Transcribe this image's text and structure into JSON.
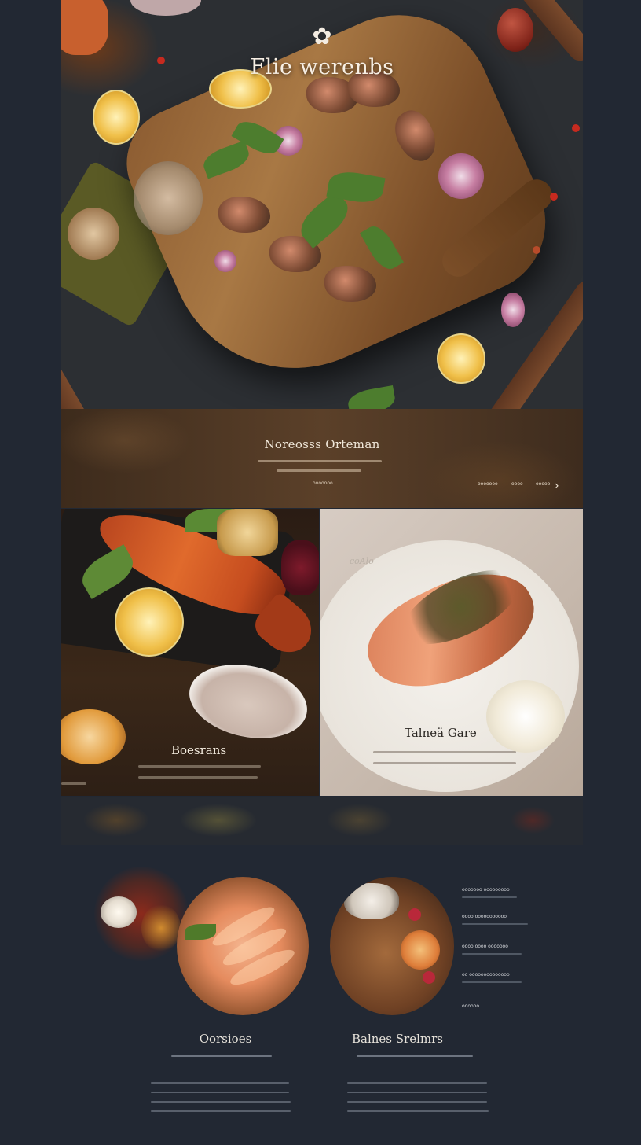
{
  "hero": {
    "title": "Flie werenbs"
  },
  "banner": {
    "title": "Noreosss Orteman",
    "nav_left": "ooooooo",
    "nav_mid": "oooo",
    "nav_right": "ooooo",
    "arrow": "›"
  },
  "cards": {
    "left": {
      "title": "Boesrans"
    },
    "right": {
      "title": "Talneä Gare",
      "plate_mark": "coAlo"
    }
  },
  "lower": {
    "sidebar": [
      {
        "title": "ooooooo ooooooooo"
      },
      {
        "title": "oooo ooooooooooo"
      },
      {
        "title": "oooo oooo ooooooo"
      },
      {
        "title": "oo oooooooooooooo"
      }
    ],
    "sidebar_more": "oooooo",
    "left_col": {
      "title": "Oorsioes"
    },
    "right_col": {
      "title": "Balnes Srelmrs"
    }
  },
  "colors": {
    "background": "#222833",
    "banner": "#4d3624",
    "accent_text": "#efe6d8"
  }
}
